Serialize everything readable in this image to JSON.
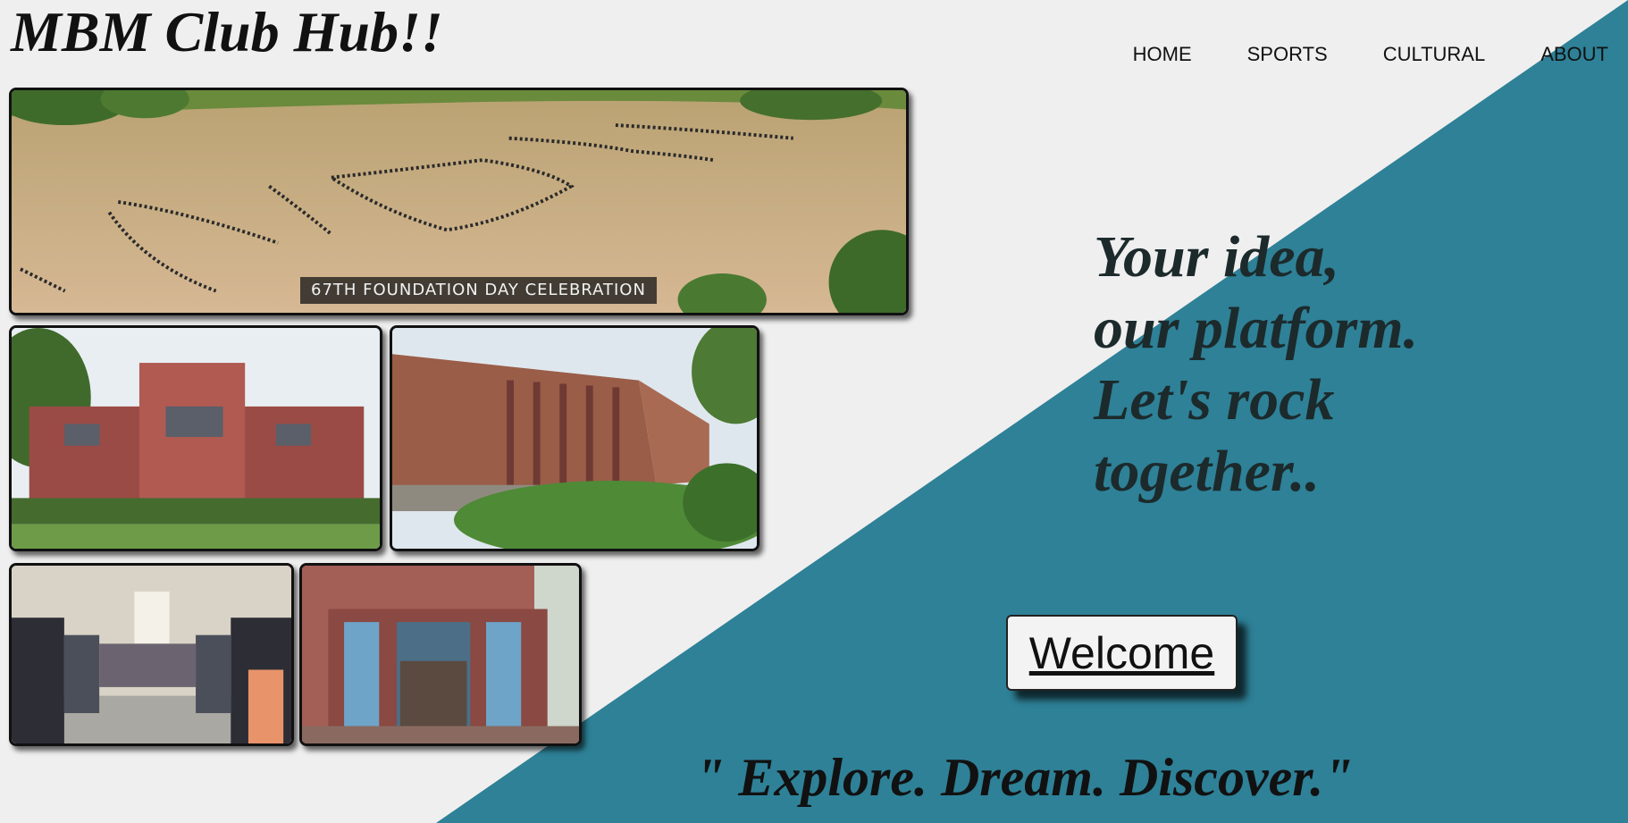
{
  "site": {
    "title": "MBM Club Hub!!"
  },
  "nav": {
    "items": [
      {
        "label": "HOME"
      },
      {
        "label": "SPORTS"
      },
      {
        "label": "CULTURAL"
      },
      {
        "label": "ABOUT"
      }
    ]
  },
  "gallery": {
    "banner_caption": "67TH FOUNDATION DAY CELEBRATION"
  },
  "hero": {
    "tagline_lines": [
      "Your idea,",
      "our platform.",
      "Let's rock",
      "together.."
    ],
    "welcome_button": "Welcome",
    "motto": "\" Explore. Dream. Discover.\""
  },
  "colors": {
    "background": "#efefef",
    "accent_teal": "#2e8197",
    "text_dark": "#111111"
  },
  "icons": []
}
